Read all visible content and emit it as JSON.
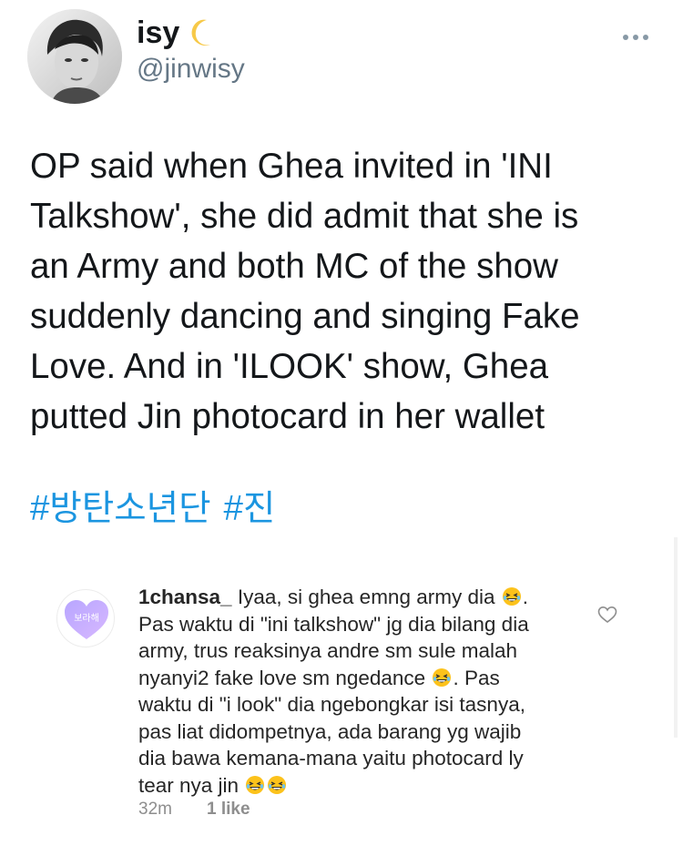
{
  "tweet": {
    "display_name": "isy",
    "name_emoji_icon": "crescent-moon-icon",
    "handle": "@jinwisy",
    "text_lines": [
      "OP said when Ghea invited in 'INI",
      "Talkshow', she did admit that she is",
      "an Army and both MC of the show",
      "suddenly dancing and singing Fake",
      "Love. And in 'ILOOK' show, Ghea",
      "putted Jin photocard in her wallet"
    ],
    "hashtags": [
      "#방탄소년단",
      "#진"
    ],
    "more_icon": "more-dots-icon",
    "colors": {
      "text": "#14171a",
      "secondary": "#657786",
      "link": "#1b95e0"
    }
  },
  "comment": {
    "avatar_icon": "purple-heart-icon",
    "avatar_text": "보라해",
    "username": "1chansa_",
    "lines": [
      [
        "Iyaa, si ghea emng army dia",
        "😂",
        "."
      ],
      [
        "Pas waktu di \"ini talkshow\" jg dia bilang dia"
      ],
      [
        "army, trus reaksinya andre sm sule malah"
      ],
      [
        "nyanyi2 fake love sm ngedance",
        "😂",
        ". Pas"
      ],
      [
        "waktu di \"i look\" dia ngebongkar isi tasnya,"
      ],
      [
        "pas liat didompetnya, ada barang yg wajib"
      ],
      [
        "dia bawa kemana-mana yaitu photocard ly"
      ],
      [
        "tear nya jin",
        "😂",
        "😂"
      ]
    ],
    "time": "32m",
    "likes": "1 like",
    "like_icon": "heart-outline-icon",
    "colors": {
      "text": "#262626",
      "meta": "#8e8e8e"
    }
  }
}
